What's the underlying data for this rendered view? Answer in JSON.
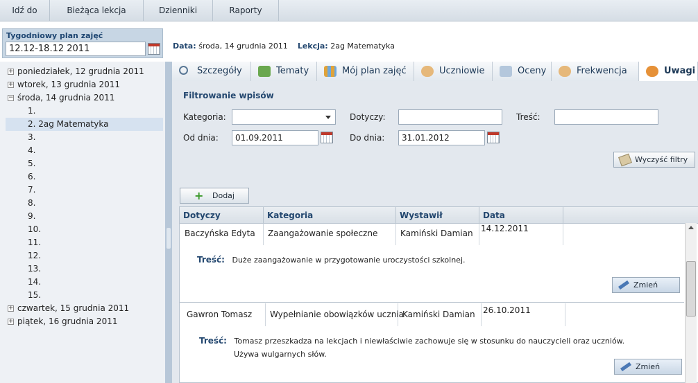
{
  "topnav": [
    {
      "label": "Idź do"
    },
    {
      "label": "Bieżąca lekcja"
    },
    {
      "label": "Dzienniki"
    },
    {
      "label": "Raporty"
    }
  ],
  "week": {
    "label": "Tygodniowy plan zajęć",
    "value": "12.12-18.12 2011"
  },
  "info": {
    "data_label": "Data:",
    "data_value": "środa, 14 grudnia 2011",
    "lekcja_label": "Lekcja:",
    "lekcja_value": "2ag  Matematyka"
  },
  "tree": {
    "days": [
      {
        "pm": "+",
        "label": "poniedziałek, 12 grudnia 2011"
      },
      {
        "pm": "+",
        "label": "wtorek, 13 grudnia 2011"
      },
      {
        "pm": "−",
        "label": "środa, 14 grudnia 2011"
      },
      {
        "pm": "+",
        "label": "czwartek, 15 grudnia 2011"
      },
      {
        "pm": "+",
        "label": "piątek, 16 grudnia 2011"
      }
    ],
    "lessons": [
      "1.",
      "2. 2ag  Matematyka",
      "3.",
      "4.",
      "5.",
      "6.",
      "7.",
      "8.",
      "9.",
      "10.",
      "11.",
      "12.",
      "13.",
      "14.",
      "15."
    ]
  },
  "tabs": [
    {
      "label": "Szczegóły",
      "icon": "magnifier-icon"
    },
    {
      "label": "Tematy",
      "icon": "question-icon"
    },
    {
      "label": "Mój plan zajęć",
      "icon": "schedule-icon"
    },
    {
      "label": "Uczniowie",
      "icon": "students-icon"
    },
    {
      "label": "Oceny",
      "icon": "grades-icon"
    },
    {
      "label": "Frekwencja",
      "icon": "attendance-icon"
    },
    {
      "label": "Uwagi",
      "icon": "notes-icon"
    }
  ],
  "filters": {
    "title": "Filtrowanie wpisów",
    "kategoria_label": "Kategoria:",
    "kategoria_value": "",
    "dotyczy_label": "Dotyczy:",
    "dotyczy_value": "",
    "tresc_label": "Treść:",
    "tresc_value": "",
    "od_label": "Od dnia:",
    "od_value": "01.09.2011",
    "do_label": "Do dnia:",
    "do_value": "31.01.2012",
    "clear_label": "Wyczyść filtry"
  },
  "add_label": "Dodaj",
  "grid": {
    "headers": [
      "Dotyczy",
      "Kategoria",
      "Wystawił",
      "Data"
    ],
    "tresc_label": "Treść:",
    "edit_label": "Zmień",
    "rows": [
      {
        "dotyczy": "Baczyńska Edyta",
        "kategoria": "Zaangażowanie społeczne",
        "wystawil": "Kamiński Damian",
        "data": "14.12.2011",
        "tresc_1": "Duże zaangażowanie w przygotowanie uroczystości szkolnej.",
        "tresc_2": ""
      },
      {
        "dotyczy": "Gawron Tomasz",
        "kategoria": "Wypełnianie obowiązków ucznia",
        "wystawil": "Kamiński Damian",
        "data": "26.10.2011",
        "tresc_1": "Tomasz przeszkadza na lekcjach i niewłaściwie zachowuje się w stosunku do nauczycieli oraz uczniów.",
        "tresc_2": "Używa wulgarnych słów."
      }
    ]
  },
  "colors": {
    "accent": "#23476f",
    "panel": "#e3e8ee",
    "tree_bg": "#eef1f5",
    "selected": "#d6e2f0"
  }
}
